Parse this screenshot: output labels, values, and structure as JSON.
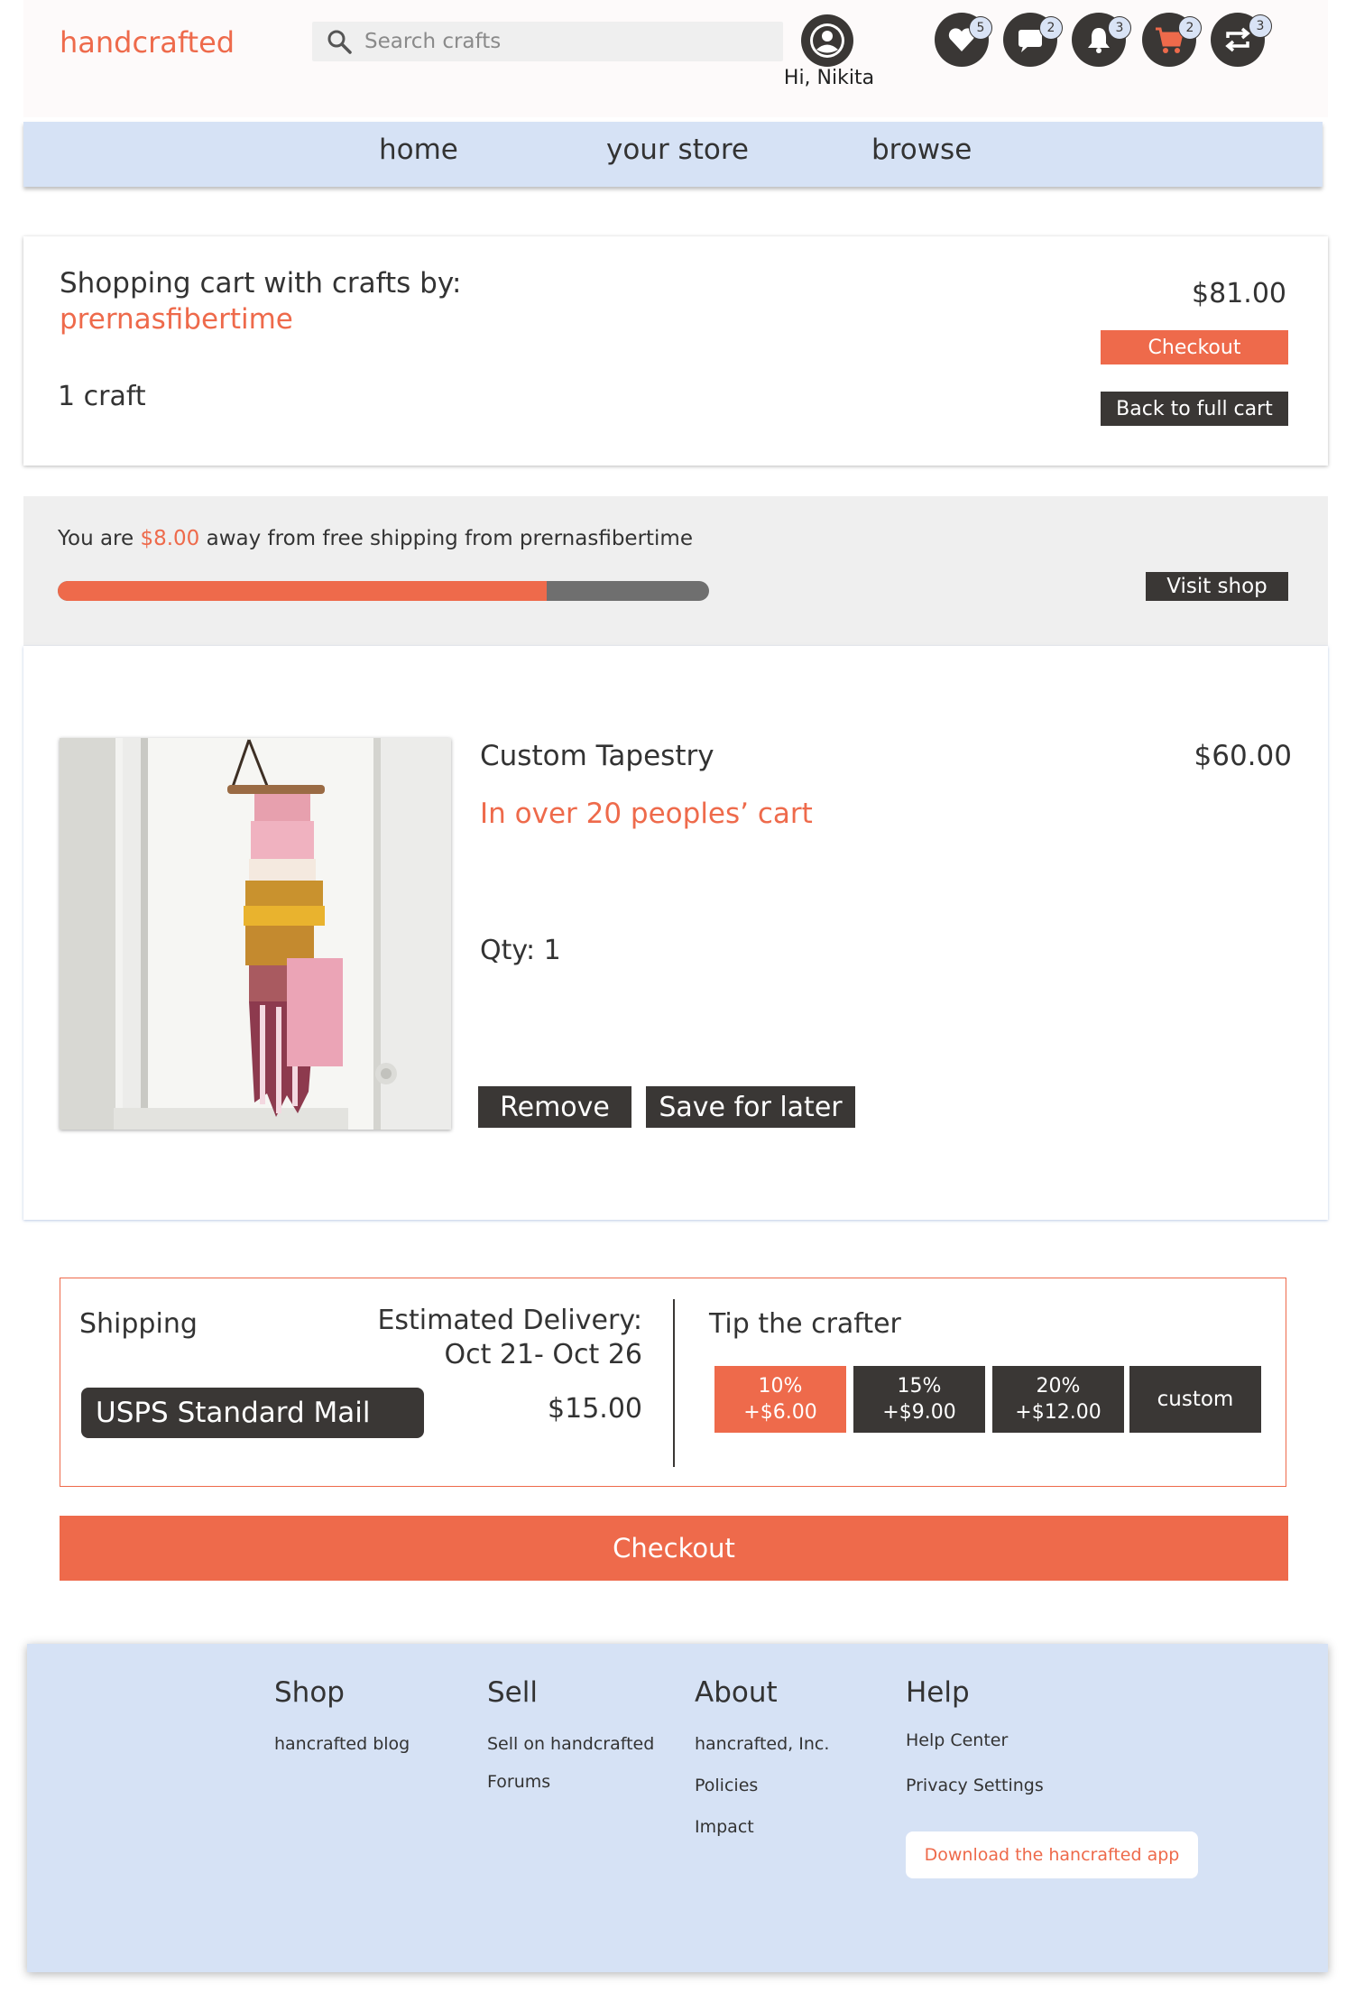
{
  "header": {
    "logo": "handcrafted",
    "search_placeholder": "Search crafts",
    "greeting": "Hi, Nikita",
    "badges": {
      "favorites": "5",
      "messages": "2",
      "notifications": "3",
      "cart": "2",
      "exchange": "3"
    }
  },
  "nav": {
    "home": "home",
    "store": "your store",
    "browse": "browse"
  },
  "cart_summary": {
    "title": "Shopping cart with crafts by:",
    "shop_name": "prernasfibertime",
    "count": "1 craft",
    "total": "$81.00",
    "checkout_label": "Checkout",
    "back_label": "Back to full cart"
  },
  "free_shipping": {
    "prefix": "You are ",
    "amount": "$8.00",
    "suffix": " away from free shipping from prernasfibertime",
    "progress_percent": 75,
    "visit_label": "Visit shop"
  },
  "item": {
    "title": "Custom Tapestry",
    "price": "$60.00",
    "popularity": "In over 20 peoples’ cart",
    "qty": "Qty: 1",
    "remove_label": "Remove",
    "save_label": "Save for later"
  },
  "shipping": {
    "heading": "Shipping",
    "delivery_label": "Estimated Delivery:",
    "delivery_dates": "Oct 21- Oct 26",
    "method": "USPS Standard Mail",
    "cost": "$15.00"
  },
  "tip": {
    "heading": "Tip the crafter",
    "options": [
      {
        "percent": "10%",
        "amount": "+$6.00"
      },
      {
        "percent": "15%",
        "amount": "+$9.00"
      },
      {
        "percent": "20%",
        "amount": "+$12.00"
      }
    ],
    "custom_label": "custom"
  },
  "checkout_label": "Checkout",
  "footer": {
    "shop": {
      "heading": "Shop",
      "links": [
        "hancrafted blog"
      ]
    },
    "sell": {
      "heading": "Sell",
      "links": [
        "Sell on handcrafted",
        "Forums"
      ]
    },
    "about": {
      "heading": "About",
      "links": [
        "hancrafted, Inc.",
        "Policies",
        "Impact"
      ]
    },
    "help": {
      "heading": "Help",
      "links": [
        "Help Center",
        "Privacy Settings"
      ],
      "app_label": "Download the hancrafted app"
    }
  },
  "colors": {
    "accent": "#ee6a4b",
    "dark": "#3a3735",
    "nav_bg": "#d6e2f5",
    "banner_bg": "#efefef"
  }
}
